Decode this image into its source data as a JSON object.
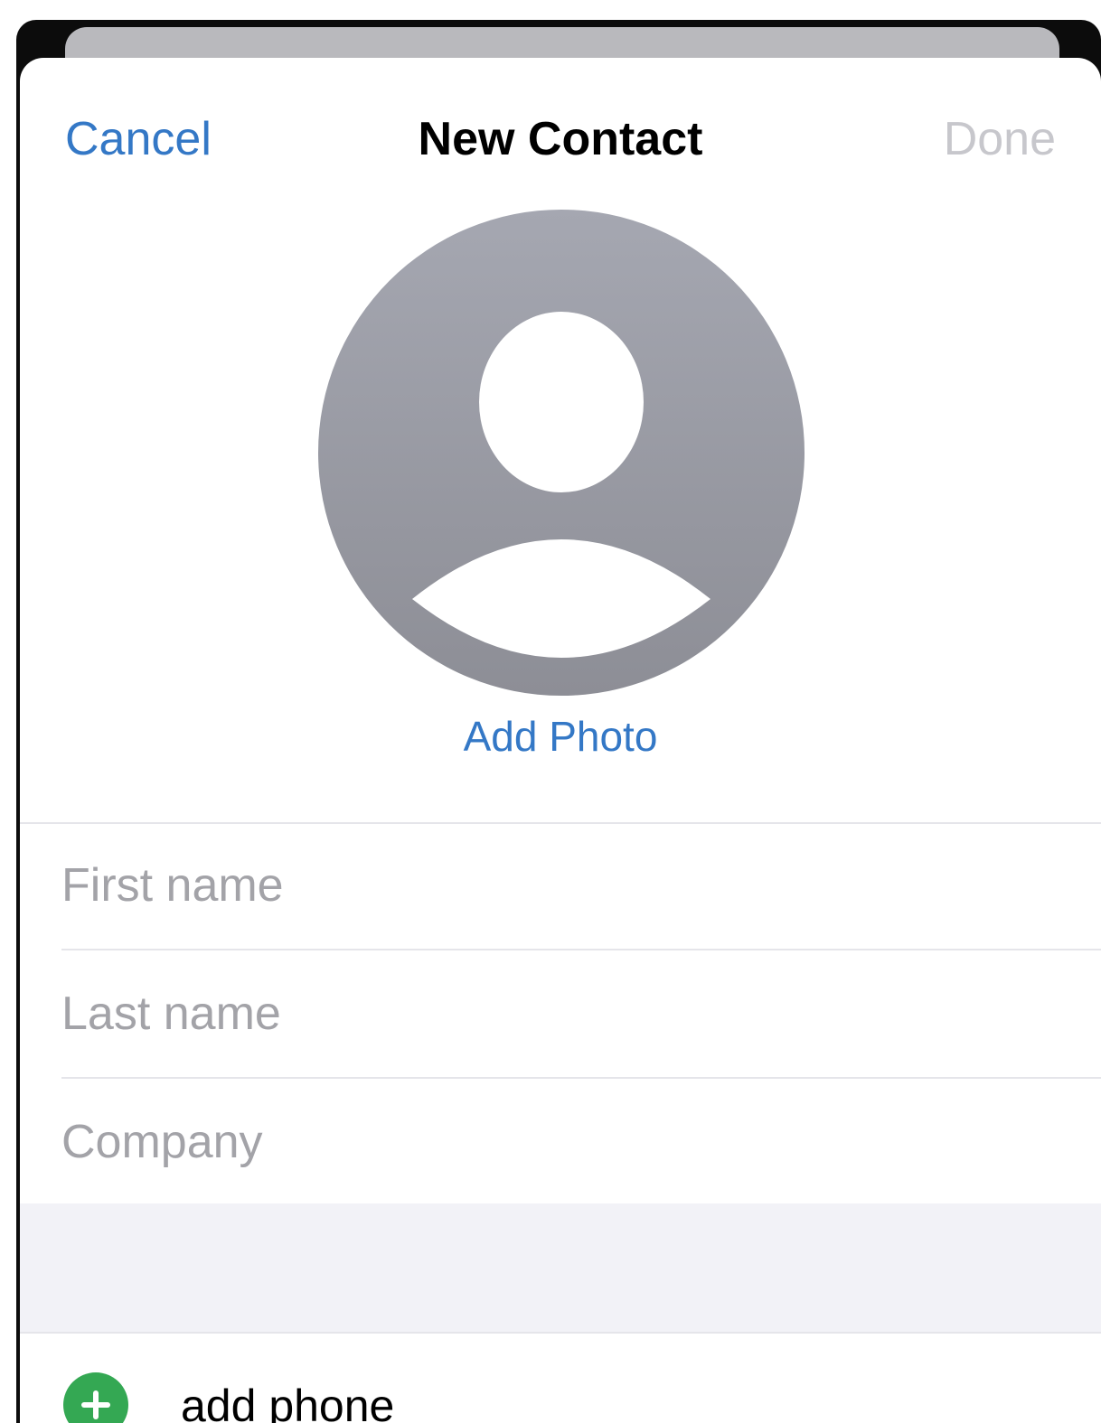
{
  "colors": {
    "accent": "#3478c6",
    "disabled": "#c7c7cc",
    "avatar": "#9a9ba3",
    "add": "#34a853"
  },
  "nav": {
    "cancel_label": "Cancel",
    "title": "New Contact",
    "done_label": "Done"
  },
  "photo": {
    "icon": "person-silhouette-icon",
    "add_label": "Add Photo"
  },
  "form": {
    "first_name": {
      "placeholder": "First name",
      "value": ""
    },
    "last_name": {
      "placeholder": "Last name",
      "value": ""
    },
    "company": {
      "placeholder": "Company",
      "value": ""
    }
  },
  "add_phone": {
    "icon": "plus-circle-icon",
    "label": "add phone"
  }
}
